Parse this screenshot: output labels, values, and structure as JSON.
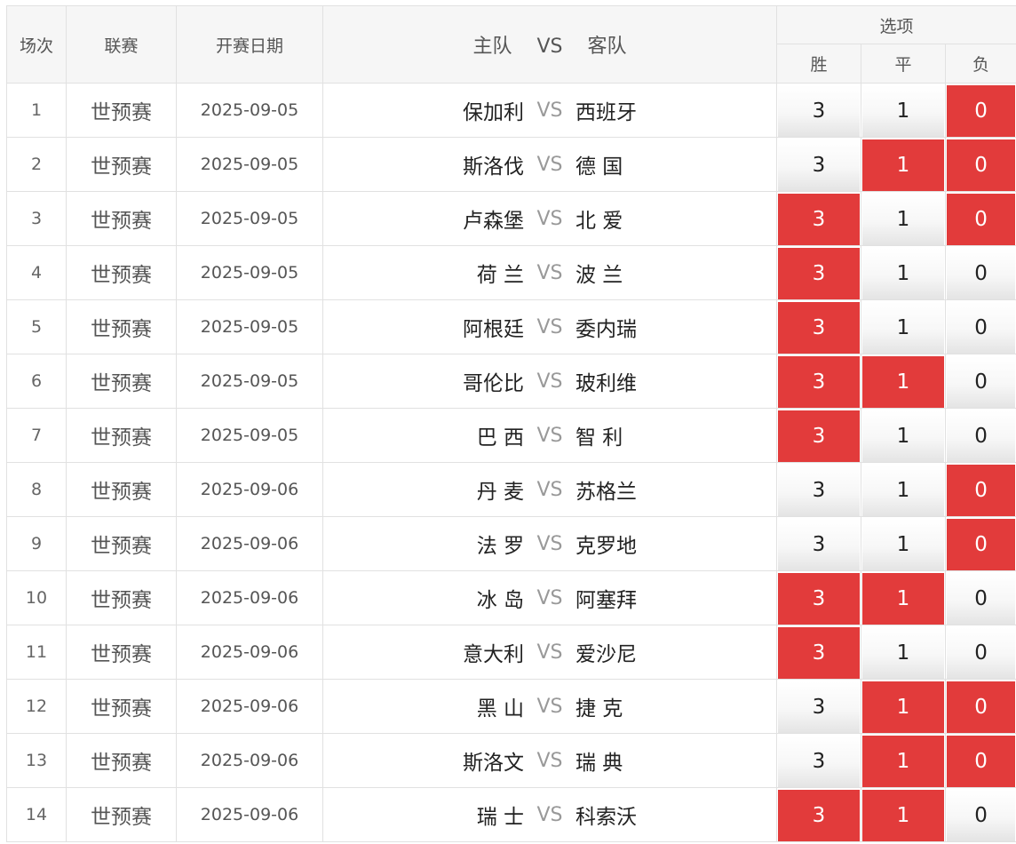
{
  "headers": {
    "index": "场次",
    "league": "联赛",
    "date": "开赛日期",
    "home": "主队",
    "vs": "VS",
    "away": "客队",
    "options": "选项",
    "win": "胜",
    "draw": "平",
    "lose": "负"
  },
  "colors": {
    "selected": "#e23b3b",
    "header_bg": "#f6f6f6"
  },
  "matches": [
    {
      "index": "1",
      "league": "世预赛",
      "date": "2025-09-05",
      "home": "保加利",
      "vs": "VS",
      "away": "西班牙",
      "win": "3",
      "draw": "1",
      "lose": "0",
      "selected": [
        "lose"
      ]
    },
    {
      "index": "2",
      "league": "世预赛",
      "date": "2025-09-05",
      "home": "斯洛伐",
      "vs": "VS",
      "away": "德 国",
      "win": "3",
      "draw": "1",
      "lose": "0",
      "selected": [
        "draw",
        "lose"
      ]
    },
    {
      "index": "3",
      "league": "世预赛",
      "date": "2025-09-05",
      "home": "卢森堡",
      "vs": "VS",
      "away": "北 爱",
      "win": "3",
      "draw": "1",
      "lose": "0",
      "selected": [
        "win",
        "lose"
      ]
    },
    {
      "index": "4",
      "league": "世预赛",
      "date": "2025-09-05",
      "home": "荷 兰",
      "vs": "VS",
      "away": "波 兰",
      "win": "3",
      "draw": "1",
      "lose": "0",
      "selected": [
        "win"
      ]
    },
    {
      "index": "5",
      "league": "世预赛",
      "date": "2025-09-05",
      "home": "阿根廷",
      "vs": "VS",
      "away": "委内瑞",
      "win": "3",
      "draw": "1",
      "lose": "0",
      "selected": [
        "win"
      ]
    },
    {
      "index": "6",
      "league": "世预赛",
      "date": "2025-09-05",
      "home": "哥伦比",
      "vs": "VS",
      "away": "玻利维",
      "win": "3",
      "draw": "1",
      "lose": "0",
      "selected": [
        "win",
        "draw"
      ]
    },
    {
      "index": "7",
      "league": "世预赛",
      "date": "2025-09-05",
      "home": "巴 西",
      "vs": "VS",
      "away": "智 利",
      "win": "3",
      "draw": "1",
      "lose": "0",
      "selected": [
        "win"
      ]
    },
    {
      "index": "8",
      "league": "世预赛",
      "date": "2025-09-06",
      "home": "丹 麦",
      "vs": "VS",
      "away": "苏格兰",
      "win": "3",
      "draw": "1",
      "lose": "0",
      "selected": [
        "lose"
      ]
    },
    {
      "index": "9",
      "league": "世预赛",
      "date": "2025-09-06",
      "home": "法 罗",
      "vs": "VS",
      "away": "克罗地",
      "win": "3",
      "draw": "1",
      "lose": "0",
      "selected": [
        "lose"
      ]
    },
    {
      "index": "10",
      "league": "世预赛",
      "date": "2025-09-06",
      "home": "冰 岛",
      "vs": "VS",
      "away": "阿塞拜",
      "win": "3",
      "draw": "1",
      "lose": "0",
      "selected": [
        "win",
        "draw"
      ]
    },
    {
      "index": "11",
      "league": "世预赛",
      "date": "2025-09-06",
      "home": "意大利",
      "vs": "VS",
      "away": "爱沙尼",
      "win": "3",
      "draw": "1",
      "lose": "0",
      "selected": [
        "win"
      ]
    },
    {
      "index": "12",
      "league": "世预赛",
      "date": "2025-09-06",
      "home": "黑 山",
      "vs": "VS",
      "away": "捷 克",
      "win": "3",
      "draw": "1",
      "lose": "0",
      "selected": [
        "draw",
        "lose"
      ]
    },
    {
      "index": "13",
      "league": "世预赛",
      "date": "2025-09-06",
      "home": "斯洛文",
      "vs": "VS",
      "away": "瑞 典",
      "win": "3",
      "draw": "1",
      "lose": "0",
      "selected": [
        "draw",
        "lose"
      ]
    },
    {
      "index": "14",
      "league": "世预赛",
      "date": "2025-09-06",
      "home": "瑞 士",
      "vs": "VS",
      "away": "科索沃",
      "win": "3",
      "draw": "1",
      "lose": "0",
      "selected": [
        "win",
        "draw"
      ]
    }
  ]
}
